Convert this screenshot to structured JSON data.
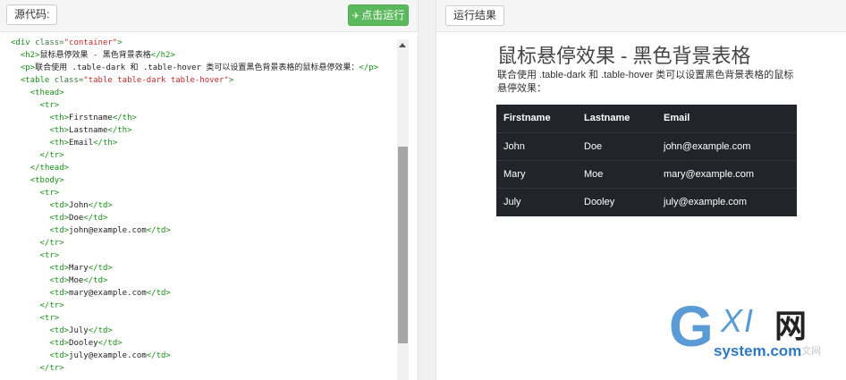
{
  "toolbar": {
    "source_label": "源代码:",
    "run_label": "点击运行",
    "result_label": "运行结果"
  },
  "code_lines": [
    [
      [
        "tag",
        "<div "
      ],
      [
        "attr",
        "class="
      ],
      [
        "str",
        "\"container\""
      ],
      [
        "tag",
        ">"
      ]
    ],
    [
      [
        "plain",
        "  "
      ],
      [
        "tag",
        "<h2>"
      ],
      [
        "plain",
        "鼠标悬停效果 - 黑色背景表格"
      ],
      [
        "tag",
        "</h2>"
      ]
    ],
    [
      [
        "plain",
        "  "
      ],
      [
        "tag",
        "<p>"
      ],
      [
        "plain",
        "联合使用 .table-dark 和 .table-hover 类可以设置黑色背景表格的鼠标悬停效果："
      ],
      [
        "tag",
        "</p>"
      ]
    ],
    [
      [
        "plain",
        "  "
      ],
      [
        "tag",
        "<table "
      ],
      [
        "attr",
        "class="
      ],
      [
        "str",
        "\"table table-dark table-hover\""
      ],
      [
        "tag",
        ">"
      ]
    ],
    [
      [
        "plain",
        "    "
      ],
      [
        "tag",
        "<thead>"
      ]
    ],
    [
      [
        "plain",
        "      "
      ],
      [
        "tag",
        "<tr>"
      ]
    ],
    [
      [
        "plain",
        "        "
      ],
      [
        "tag",
        "<th>"
      ],
      [
        "plain",
        "Firstname"
      ],
      [
        "tag",
        "</th>"
      ]
    ],
    [
      [
        "plain",
        "        "
      ],
      [
        "tag",
        "<th>"
      ],
      [
        "plain",
        "Lastname"
      ],
      [
        "tag",
        "</th>"
      ]
    ],
    [
      [
        "plain",
        "        "
      ],
      [
        "tag",
        "<th>"
      ],
      [
        "plain",
        "Email"
      ],
      [
        "tag",
        "</th>"
      ]
    ],
    [
      [
        "plain",
        "      "
      ],
      [
        "tag",
        "</tr>"
      ]
    ],
    [
      [
        "plain",
        "    "
      ],
      [
        "tag",
        "</thead>"
      ]
    ],
    [
      [
        "plain",
        "    "
      ],
      [
        "tag",
        "<tbody>"
      ]
    ],
    [
      [
        "plain",
        "      "
      ],
      [
        "tag",
        "<tr>"
      ]
    ],
    [
      [
        "plain",
        "        "
      ],
      [
        "tag",
        "<td>"
      ],
      [
        "plain",
        "John"
      ],
      [
        "tag",
        "</td>"
      ]
    ],
    [
      [
        "plain",
        "        "
      ],
      [
        "tag",
        "<td>"
      ],
      [
        "plain",
        "Doe"
      ],
      [
        "tag",
        "</td>"
      ]
    ],
    [
      [
        "plain",
        "        "
      ],
      [
        "tag",
        "<td>"
      ],
      [
        "plain",
        "john@example.com"
      ],
      [
        "tag",
        "</td>"
      ]
    ],
    [
      [
        "plain",
        "      "
      ],
      [
        "tag",
        "</tr>"
      ]
    ],
    [
      [
        "plain",
        "      "
      ],
      [
        "tag",
        "<tr>"
      ]
    ],
    [
      [
        "plain",
        "        "
      ],
      [
        "tag",
        "<td>"
      ],
      [
        "plain",
        "Mary"
      ],
      [
        "tag",
        "</td>"
      ]
    ],
    [
      [
        "plain",
        "        "
      ],
      [
        "tag",
        "<td>"
      ],
      [
        "plain",
        "Moe"
      ],
      [
        "tag",
        "</td>"
      ]
    ],
    [
      [
        "plain",
        "        "
      ],
      [
        "tag",
        "<td>"
      ],
      [
        "plain",
        "mary@example.com"
      ],
      [
        "tag",
        "</td>"
      ]
    ],
    [
      [
        "plain",
        "      "
      ],
      [
        "tag",
        "</tr>"
      ]
    ],
    [
      [
        "plain",
        "      "
      ],
      [
        "tag",
        "<tr>"
      ]
    ],
    [
      [
        "plain",
        "        "
      ],
      [
        "tag",
        "<td>"
      ],
      [
        "plain",
        "July"
      ],
      [
        "tag",
        "</td>"
      ]
    ],
    [
      [
        "plain",
        "        "
      ],
      [
        "tag",
        "<td>"
      ],
      [
        "plain",
        "Dooley"
      ],
      [
        "tag",
        "</td>"
      ]
    ],
    [
      [
        "plain",
        "        "
      ],
      [
        "tag",
        "<td>"
      ],
      [
        "plain",
        "july@example.com"
      ],
      [
        "tag",
        "</td>"
      ]
    ],
    [
      [
        "plain",
        "      "
      ],
      [
        "tag",
        "</tr>"
      ]
    ]
  ],
  "preview": {
    "title": "鼠标悬停效果 - 黑色背景表格",
    "description": "联合使用 .table-dark 和 .table-hover 类可以设置黑色背景表格的鼠标悬停效果：",
    "table": {
      "headers": [
        "Firstname",
        "Lastname",
        "Email"
      ],
      "rows": [
        [
          "John",
          "Doe",
          "john@example.com"
        ],
        [
          "Mary",
          "Moe",
          "mary@example.com"
        ],
        [
          "July",
          "Dooley",
          "july@example.com"
        ]
      ]
    }
  },
  "watermark": {
    "g": "G",
    "xi": "XI",
    "wang": "网",
    "site": "system.com",
    "faint": "文网"
  },
  "colors": {
    "run_button": "#5cb85c",
    "table_bg": "#212529",
    "tag": "#1a8f1a",
    "string": "#c22a2a",
    "watermark_blue": "#5b9bd5"
  },
  "icons": {
    "run_icon": "send-icon"
  }
}
